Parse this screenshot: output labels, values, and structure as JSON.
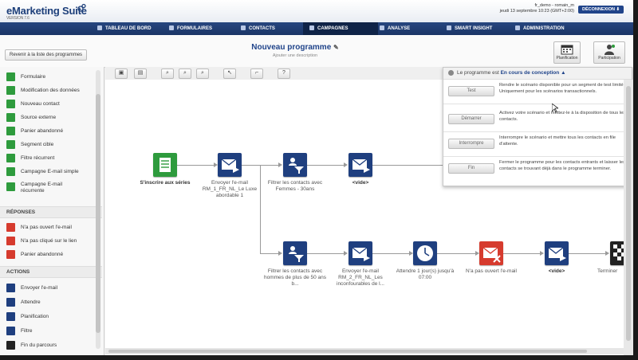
{
  "header": {
    "app_name": "eMarketing Suite",
    "version": "VERSION 7.6",
    "user_line": "fr_demo - romain_m",
    "date_line": "jeudi 13 septembre 10:23 (GMT+2:00)",
    "logout_label": "DÉCONNEXION"
  },
  "nav": {
    "items": [
      {
        "label": "TABLEAU DE BORD"
      },
      {
        "label": "FORMULAIRES"
      },
      {
        "label": "CONTACTS"
      },
      {
        "label": "CAMPAGNES"
      },
      {
        "label": "ANALYSE"
      },
      {
        "label": "SMART INSIGHT"
      },
      {
        "label": "ADMINISTRATION"
      }
    ],
    "active_index": 3
  },
  "subheader": {
    "back_label": "Revenir à la liste des programmes",
    "title": "Nouveau programme",
    "description_placeholder": "Ajouter une description",
    "planning_label": "Planification",
    "participation_label": "Participation"
  },
  "sidebar": {
    "entries": [
      {
        "label": "Formulaire"
      },
      {
        "label": "Modification des données"
      },
      {
        "label": "Nouveau contact"
      },
      {
        "label": "Source externe"
      },
      {
        "label": "Panier abandonné"
      },
      {
        "label": "Segment cible"
      },
      {
        "label": "Filtre récurrent"
      },
      {
        "label": "Campagne E-mail simple"
      },
      {
        "label": "Campagne E-mail récurrente"
      }
    ],
    "responses_title": "RÉPONSES",
    "responses": [
      {
        "label": "N'a pas ouvert l'e-mail"
      },
      {
        "label": "N'a pas cliqué sur le lien"
      },
      {
        "label": "Panier abandonné"
      }
    ],
    "actions_title": "ACTIONS",
    "actions": [
      {
        "label": "Envoyer l'e-mail"
      },
      {
        "label": "Attendre"
      },
      {
        "label": "Planification"
      },
      {
        "label": "Filtre"
      },
      {
        "label": "Fin du parcours"
      }
    ]
  },
  "flow": {
    "top": [
      {
        "label": "S'inscrire aux séries"
      },
      {
        "label": "Envoyer l'e-mail RM_1_FR_NL_Le Luxe abordable 1"
      },
      {
        "label": "Filtrer les contacts avec Femmes - 30ans"
      },
      {
        "label": "<vide>"
      }
    ],
    "bottom": [
      {
        "label": "Filtrer les contacts avec hommes de plus de 50 ans b..."
      },
      {
        "label": "Envoyer l'e-mail RM_2_FR_NL_Les inconfourables de l..."
      },
      {
        "label": "Attendre 1 jour(s) jusqu'à 07:00"
      },
      {
        "label": "N'a pas ouvert l'e-mail"
      },
      {
        "label": "<vide>"
      },
      {
        "label": "Terminer"
      }
    ]
  },
  "status_panel": {
    "prefix": "Le programme est",
    "status": "En cours de conception",
    "rows": [
      {
        "button": "Test",
        "description": "Rendre le scénario disponible pour un segment de test limité. Uniquement pour les scénarios transactionnels."
      },
      {
        "button": "Démarrer",
        "description": "Activez votre scénario et mettez-le à la disposition de tous les contacts."
      },
      {
        "button": "Interrompre",
        "description": "Interrompre le scénario et mettre tous les contacts en file d'attente."
      },
      {
        "button": "Fin",
        "description": "Fermer le programme pour les contacts entrants et laisser les contacts se trouvant déjà dans le programme terminer."
      }
    ]
  },
  "colors": {
    "brand": "#20448a",
    "nav": "#1b3566",
    "green": "#2e9b3d",
    "red": "#d63b2e",
    "node": "#1f3f7f"
  }
}
